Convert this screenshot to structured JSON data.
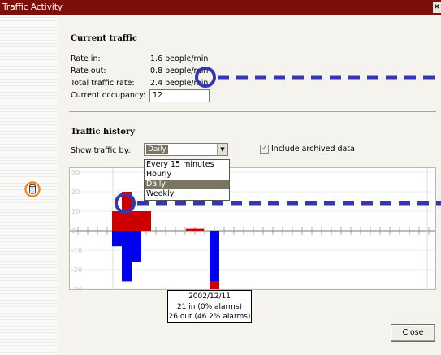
{
  "window": {
    "title": "Traffic Activity",
    "close_glyph": "×"
  },
  "current_traffic": {
    "heading": "Current traffic",
    "rate_in_label": "Rate in:",
    "rate_in_value": "1.6 people/min",
    "rate_out_label": "Rate out:",
    "rate_out_value": "0.8 people/min",
    "total_label": "Total traffic rate:",
    "total_value": "2.4 people/min",
    "occupancy_label": "Current occupancy:",
    "occupancy_value": "12"
  },
  "traffic_history": {
    "heading": "Traffic history",
    "show_by_label": "Show traffic by:",
    "selected": "Daily",
    "options": [
      "Every 15 minutes",
      "Hourly",
      "Daily",
      "Weekly"
    ],
    "include_archived_label": "Include archived data",
    "include_archived_checked": true,
    "dropdown_arrow": "▼",
    "check_mark": "✓"
  },
  "tooltip": {
    "date": "2002/12/11",
    "in_line": "21 in (0% alarms)",
    "out_line": "26 out (46.2% alarms)"
  },
  "buttons": {
    "close_label": "Close"
  },
  "colors": {
    "title_bar": "#7d0e08",
    "in_normal": "#cc0000",
    "out_normal": "#0000ee",
    "out_alarm": "#cc0000",
    "annotation": "#3636b0",
    "icon_ring": "#f08a2a"
  },
  "chart_data": {
    "type": "bar",
    "ylim": [
      -30,
      30
    ],
    "y_ticks": [
      30,
      20,
      10,
      0,
      -10,
      -20,
      -30
    ],
    "series": [
      {
        "name": "in",
        "values": [
          10,
          20,
          10,
          10,
          1,
          1,
          0
        ]
      },
      {
        "name": "out",
        "values": [
          -8,
          -26,
          -16,
          0,
          0,
          0,
          -26
        ]
      },
      {
        "name": "out alarms",
        "values": [
          0,
          0,
          0,
          0,
          0,
          0,
          -12
        ]
      }
    ]
  }
}
